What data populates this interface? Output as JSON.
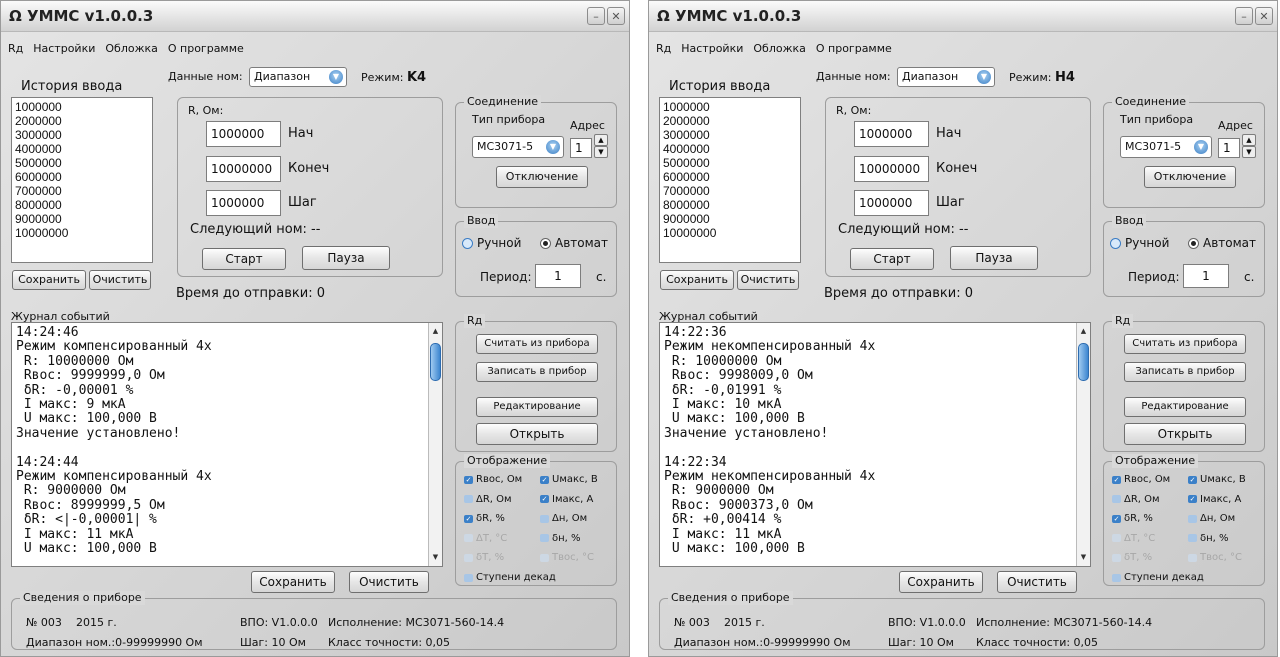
{
  "windows": [
    {
      "title": "УММС v1.0.0.3",
      "title_symbol": "Ω",
      "menu": [
        "Rд",
        "Настройки",
        "Обложка",
        "О программе"
      ],
      "history_label": "История ввода",
      "history_items": [
        "1000000",
        "2000000",
        "3000000",
        "4000000",
        "5000000",
        "6000000",
        "7000000",
        "8000000",
        "9000000",
        "10000000"
      ],
      "save_history": "Сохранить",
      "clear_history": "Очистить",
      "data_nom_label": "Данные ном:",
      "data_nom_value": "Диапазон",
      "mode_label": "Режим:",
      "mode_value": "K4",
      "r_label": "R, Ом:",
      "start_value": "1000000",
      "start_label": "Нач",
      "end_value": "10000000",
      "end_label": "Конеч",
      "step_value": "1000000",
      "step_label": "Шаг",
      "next_nom": "Следующий ном: --",
      "start_btn": "Старт",
      "pause_btn": "Пауза",
      "time_to_send": "Время до отправки: 0",
      "connection_title": "Соединение",
      "device_type_label": "Тип прибора",
      "address_label": "Адрес",
      "device_type_value": "МС3071-5",
      "address_value": "1",
      "disconnect_btn": "Отключение",
      "input_title": "Ввод",
      "manual_label": "Ручной",
      "auto_label": "Автомат",
      "period_label": "Период:",
      "period_value": "1",
      "period_unit": "с.",
      "log_title": "Журнал событий",
      "log_text": "14:24:46\nРежим компенсированный 4х\n R: 10000000 Ом\n Rвос: 9999999,0 Ом\n δR: -0,00001 %\n I макс: 9 мкА\n U макс: 100,000 В\nЗначение установлено!\n\n14:24:44\nРежим компенсированный 4х\n R: 9000000 Ом\n Rвос: 8999999,5 Ом\n δR: <|-0,00001| %\n I макс: 11 мкА\n U макс: 100,000 В",
      "log_save": "Сохранить",
      "log_clear": "Очистить",
      "rd_title": "Rд",
      "read_btn": "Считать из прибора",
      "write_btn": "Записать в прибор",
      "edit_btn": "Редактирование",
      "open_btn": "Открыть",
      "display_title": "Отображение",
      "display_items": [
        {
          "label": "Rвос, Ом",
          "state": "on"
        },
        {
          "label": "Uмакс, В",
          "state": "on"
        },
        {
          "label": "ΔR, Ом",
          "state": "off"
        },
        {
          "label": "Iмакс, А",
          "state": "on"
        },
        {
          "label": "δR, %",
          "state": "on"
        },
        {
          "label": "Δн, Ом",
          "state": "off"
        },
        {
          "label": "ΔT, °C",
          "state": "dim"
        },
        {
          "label": "δн, %",
          "state": "off"
        },
        {
          "label": "δT, %",
          "state": "dim"
        },
        {
          "label": "Tвос, °C",
          "state": "dim"
        }
      ],
      "decade_steps": "Ступени декад",
      "device_info_title": "Сведения о приборе",
      "info_no": "№ 003",
      "info_year": "2015 г.",
      "info_vpo": "ВПО: V1.0.0.0",
      "info_exec": "Исполнение: МС3071-560-14.4",
      "info_range": "Диапазон ном.:0-99999990 Ом",
      "info_step": "Шаг: 10 Ом",
      "info_class": "Класс точности: 0,05"
    },
    {
      "title": "УММС v1.0.0.3",
      "title_symbol": "Ω",
      "menu": [
        "Rд",
        "Настройки",
        "Обложка",
        "О программе"
      ],
      "history_label": "История ввода",
      "history_items": [
        "1000000",
        "2000000",
        "3000000",
        "4000000",
        "5000000",
        "6000000",
        "7000000",
        "8000000",
        "9000000",
        "10000000"
      ],
      "save_history": "Сохранить",
      "clear_history": "Очистить",
      "data_nom_label": "Данные ном:",
      "data_nom_value": "Диапазон",
      "mode_label": "Режим:",
      "mode_value": "H4",
      "r_label": "R, Ом:",
      "start_value": "1000000",
      "start_label": "Нач",
      "end_value": "10000000",
      "end_label": "Конеч",
      "step_value": "1000000",
      "step_label": "Шаг",
      "next_nom": "Следующий ном: --",
      "start_btn": "Старт",
      "pause_btn": "Пауза",
      "time_to_send": "Время до отправки: 0",
      "connection_title": "Соединение",
      "device_type_label": "Тип прибора",
      "address_label": "Адрес",
      "device_type_value": "МС3071-5",
      "address_value": "1",
      "disconnect_btn": "Отключение",
      "input_title": "Ввод",
      "manual_label": "Ручной",
      "auto_label": "Автомат",
      "period_label": "Период:",
      "period_value": "1",
      "period_unit": "с.",
      "log_title": "Журнал событий",
      "log_text": "14:22:36\nРежим некомпенсированный 4х\n R: 10000000 Ом\n Rвос: 9998009,0 Ом\n δR: -0,01991 %\n I макс: 10 мкА\n U макс: 100,000 В\nЗначение установлено!\n\n14:22:34\nРежим некомпенсированный 4х\n R: 9000000 Ом\n Rвос: 9000373,0 Ом\n δR: +0,00414 %\n I макс: 11 мкА\n U макс: 100,000 В",
      "log_save": "Сохранить",
      "log_clear": "Очистить",
      "rd_title": "Rд",
      "read_btn": "Считать из прибора",
      "write_btn": "Записать в прибор",
      "edit_btn": "Редактирование",
      "open_btn": "Открыть",
      "display_title": "Отображение",
      "display_items": [
        {
          "label": "Rвос, Ом",
          "state": "on"
        },
        {
          "label": "Uмакс, В",
          "state": "on"
        },
        {
          "label": "ΔR, Ом",
          "state": "off"
        },
        {
          "label": "Iмакс, А",
          "state": "on"
        },
        {
          "label": "δR, %",
          "state": "on"
        },
        {
          "label": "Δн, Ом",
          "state": "off"
        },
        {
          "label": "ΔT, °C",
          "state": "dim"
        },
        {
          "label": "δн, %",
          "state": "off"
        },
        {
          "label": "δT, %",
          "state": "dim"
        },
        {
          "label": "Tвос, °C",
          "state": "dim"
        }
      ],
      "decade_steps": "Ступени декад",
      "device_info_title": "Сведения о приборе",
      "info_no": "№ 003",
      "info_year": "2015 г.",
      "info_vpo": "ВПО: V1.0.0.0",
      "info_exec": "Исполнение: МС3071-560-14.4",
      "info_range": "Диапазон ном.:0-99999990 Ом",
      "info_step": "Шаг: 10 Ом",
      "info_class": "Класс точности: 0,05"
    }
  ]
}
